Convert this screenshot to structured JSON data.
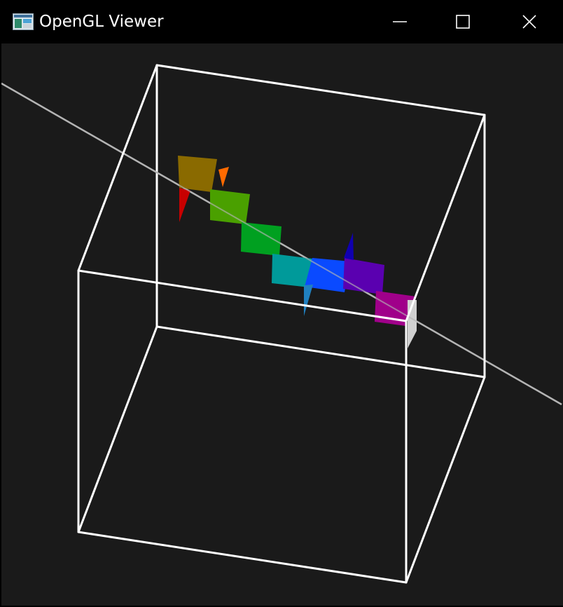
{
  "window": {
    "title": "OpenGL Viewer",
    "icon": "app-window-icon",
    "controls": {
      "minimize_icon": "minimize-icon",
      "maximize_icon": "maximize-icon",
      "close_icon": "close-icon"
    }
  },
  "colors": {
    "titlebar_bg": "#000000",
    "viewport_bg": "#1a1a1a",
    "cube_edges": "#ffffff",
    "axis_line": "#b4b4b4",
    "quads": [
      "#8a6a00",
      "#4aa000",
      "#00a020",
      "#009a9a",
      "#0a4aff",
      "#5a00b0",
      "#a0008a"
    ],
    "spikes": [
      "#c80000",
      "#ff6a00",
      "#2080c0",
      "#1000b0",
      "#d0d0d0"
    ]
  }
}
